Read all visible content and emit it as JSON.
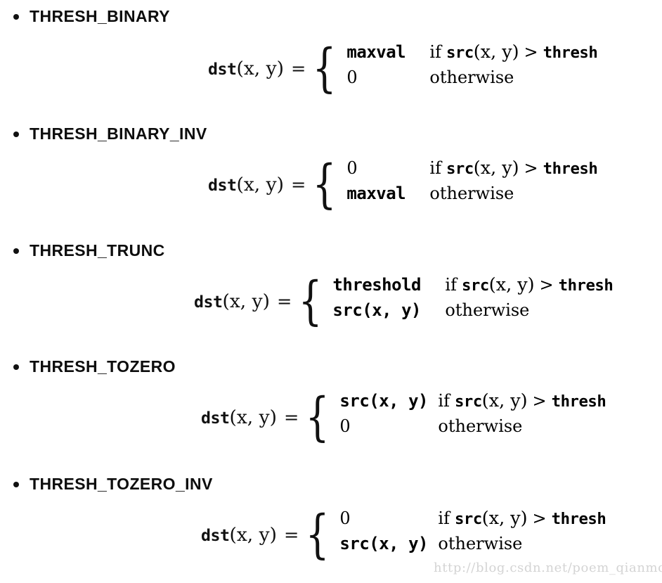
{
  "page": {
    "background_color": "#ffffff",
    "text_color": "#000000",
    "watermark": "http://blog.csdn.net/poem_qianmo"
  },
  "sections": [
    {
      "heading": "THRESH_BINARY",
      "formula": {
        "lhs_func": "dst",
        "lhs_args": "(x, y)",
        "equals": "=",
        "cases": [
          {
            "value": "maxval",
            "value_style": "mono",
            "cond_if": "if",
            "cond_func": "src",
            "cond_args": "(x, y)",
            "cond_op": ">",
            "cond_rhs": "thresh"
          },
          {
            "value": "0",
            "value_style": "serif",
            "cond_if": "otherwise"
          }
        ]
      }
    },
    {
      "heading": "THRESH_BINARY_INV",
      "formula": {
        "lhs_func": "dst",
        "lhs_args": "(x, y)",
        "equals": "=",
        "cases": [
          {
            "value": "0",
            "value_style": "serif",
            "cond_if": "if",
            "cond_func": "src",
            "cond_args": "(x, y)",
            "cond_op": ">",
            "cond_rhs": "thresh"
          },
          {
            "value": "maxval",
            "value_style": "mono",
            "cond_if": "otherwise"
          }
        ]
      }
    },
    {
      "heading": "THRESH_TRUNC",
      "formula": {
        "lhs_func": "dst",
        "lhs_args": "(x, y)",
        "equals": "=",
        "cases": [
          {
            "value": "threshold",
            "value_style": "mono",
            "cond_if": "if",
            "cond_func": "src",
            "cond_args": "(x, y)",
            "cond_op": ">",
            "cond_rhs": "thresh"
          },
          {
            "value": "src(x, y)",
            "value_style": "mono",
            "cond_if": "otherwise"
          }
        ]
      }
    },
    {
      "heading": "THRESH_TOZERO",
      "formula": {
        "lhs_func": "dst",
        "lhs_args": "(x, y)",
        "equals": "=",
        "cases": [
          {
            "value": "src(x, y)",
            "value_style": "mono",
            "cond_if": "if",
            "cond_func": "src",
            "cond_args": "(x, y)",
            "cond_op": ">",
            "cond_rhs": "thresh"
          },
          {
            "value": "0",
            "value_style": "serif",
            "cond_if": "otherwise"
          }
        ]
      }
    },
    {
      "heading": "THRESH_TOZERO_INV",
      "formula": {
        "lhs_func": "dst",
        "lhs_args": "(x, y)",
        "equals": "=",
        "cases": [
          {
            "value": "0",
            "value_style": "serif",
            "cond_if": "if",
            "cond_func": "src",
            "cond_args": "(x, y)",
            "cond_op": ">",
            "cond_rhs": "thresh"
          },
          {
            "value": "src(x, y)",
            "value_style": "mono",
            "cond_if": "otherwise"
          }
        ]
      }
    }
  ],
  "layout": {
    "section_tops": [
      8,
      175,
      341,
      506,
      673
    ],
    "formula_tops": [
      55,
      53,
      53,
      53,
      53
    ],
    "formula_lefts": [
      296,
      296,
      276,
      286,
      286
    ]
  }
}
